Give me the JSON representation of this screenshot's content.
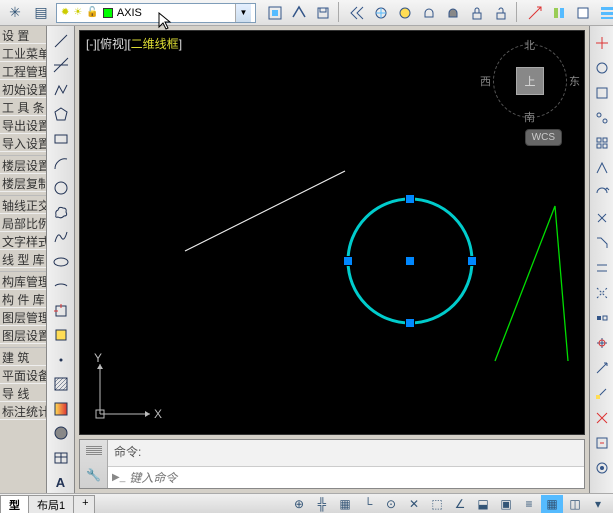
{
  "top": {
    "layer_props_label": "?",
    "layer": {
      "name": "AXIS",
      "color": "#00ff00"
    },
    "icons1": [
      "sun",
      "bulb",
      "lock",
      "pause"
    ],
    "icons_right": [
      "layer-states",
      "layer-match",
      "layer-iso",
      "layer-prev",
      "freeze",
      "thaw",
      "on",
      "off",
      "lock",
      "unlock",
      "make-current",
      "copy",
      "erase"
    ]
  },
  "left_menu": {
    "items": [
      "设 置",
      "工业菜单",
      "工程管理",
      "初始设置",
      "工 具 条",
      "导出设置",
      "导入设置",
      "",
      "楼层设置",
      "楼层复制",
      "",
      "轴线正交",
      "局部比例",
      "文字样式",
      "线 型 库",
      "",
      "构库管理",
      "构 件 库",
      "图层管理",
      "图层设置",
      "",
      "建 筑",
      "平面设备",
      "导 线",
      "标注统计"
    ]
  },
  "tool_column": {
    "tools": [
      "line",
      "construction-line",
      "polyline",
      "polygon",
      "rectangle",
      "arc",
      "circle",
      "revision-cloud",
      "spline",
      "ellipse",
      "ellipse-arc",
      "insert-block",
      "make-block",
      "point",
      "hatch",
      "gradient",
      "region",
      "table",
      "text",
      "add-selected"
    ]
  },
  "right_column": {
    "tools": [
      "r1",
      "r2",
      "r3",
      "r4",
      "r5",
      "r6",
      "r7",
      "r8",
      "r9",
      "r10",
      "r11",
      "r12",
      "r13",
      "r14",
      "r15",
      "r16",
      "r17",
      "r18",
      "r19",
      "r20"
    ]
  },
  "canvas": {
    "view_bracket1": "[-][俯视][",
    "view_bracket2": "二维线框",
    "view_bracket3": "]",
    "viewcube": {
      "north": "北",
      "south": "南",
      "east": "东",
      "west": "西",
      "top": "上"
    },
    "wcs": "WCS",
    "ucs": {
      "x": "X",
      "y": "Y"
    }
  },
  "command": {
    "history": "命令:",
    "placeholder": "键入命令",
    "prompt_icon": "▶"
  },
  "footer": {
    "tabs": [
      "型",
      "布局1"
    ],
    "tab_add": "+",
    "status_icons": [
      "infer",
      "snap",
      "grid",
      "ortho",
      "polar",
      "osnap",
      "3dosnap",
      "otrack",
      "ducs",
      "dyn",
      "lwt",
      "tpy",
      "qp",
      "sc"
    ]
  }
}
